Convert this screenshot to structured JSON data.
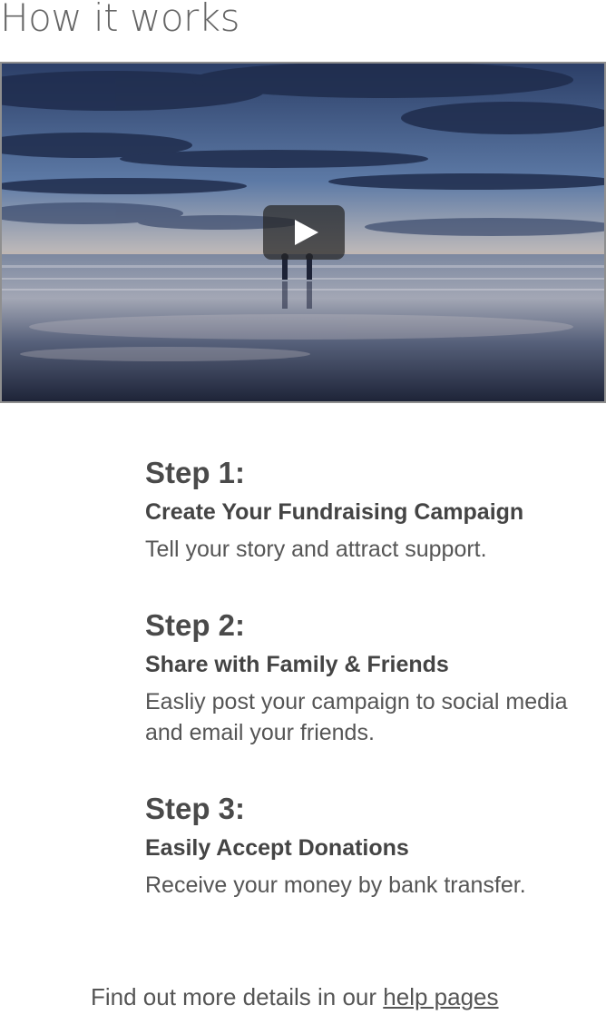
{
  "page": {
    "title": "How it works"
  },
  "video": {
    "play_icon": "play-icon"
  },
  "steps": [
    {
      "title": "Step 1:",
      "subtitle": "Create Your Fundraising Campaign",
      "description": "Tell your story and attract support."
    },
    {
      "title": "Step 2:",
      "subtitle": "Share with Family & Friends",
      "description": "Easliy post your campaign to social media and email your friends."
    },
    {
      "title": "Step 3:",
      "subtitle": "Easily Accept Donations",
      "description": "Receive your money by bank transfer."
    }
  ],
  "footer": {
    "text": "Find out more details in our ",
    "link_label": "help pages"
  },
  "colors": {
    "text_dark": "#444444",
    "text_muted": "#666666",
    "video_border": "#8f8f8f"
  }
}
